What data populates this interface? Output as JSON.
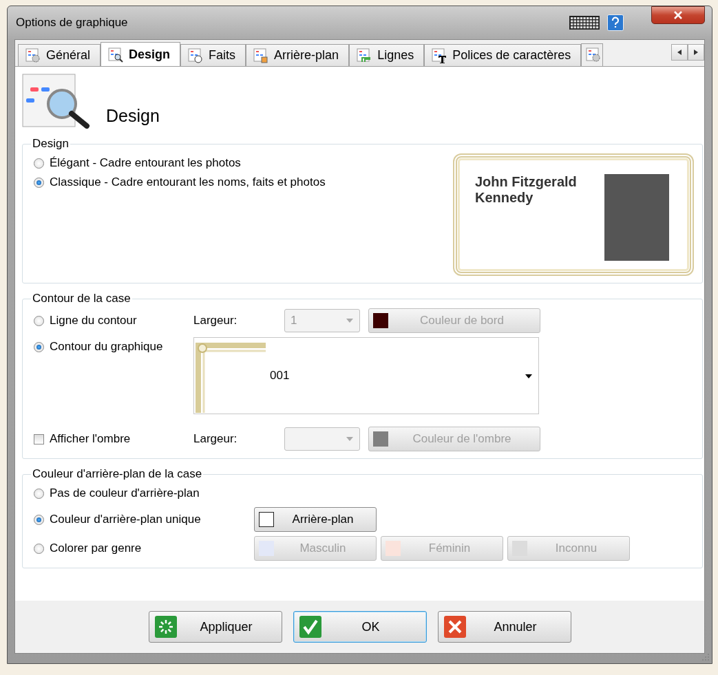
{
  "window": {
    "title": "Options de graphique"
  },
  "tabs": [
    {
      "label": "Général",
      "selected": false
    },
    {
      "label": "Design",
      "selected": true
    },
    {
      "label": "Faits",
      "selected": false
    },
    {
      "label": "Arrière-plan",
      "selected": false
    },
    {
      "label": "Lignes",
      "selected": false
    },
    {
      "label": "Polices de caractères",
      "selected": false
    }
  ],
  "header": {
    "title": "Design"
  },
  "design_group": {
    "legend": "Design",
    "options": [
      {
        "label": "Élégant - Cadre entourant les photos",
        "selected": false
      },
      {
        "label": "Classique - Cadre entourant les noms, faits et photos",
        "selected": true
      }
    ],
    "preview": {
      "name": "John Fitzgerald Kennedy"
    }
  },
  "outline_group": {
    "legend": "Contour de la case",
    "options": [
      {
        "label": "Ligne du contour",
        "selected": false
      },
      {
        "label": "Contour du graphique",
        "selected": true
      }
    ],
    "width_label": "Largeur:",
    "width_value": "1",
    "width_disabled": true,
    "border_color_button": {
      "label": "Couleur de bord",
      "color": "#3d0000",
      "disabled": true
    },
    "style_select": {
      "value": "001"
    },
    "shadow": {
      "label": "Afficher l'ombre",
      "checked": false
    },
    "shadow_width_label": "Largeur:",
    "shadow_width_disabled": true,
    "shadow_color_button": {
      "label": "Couleur de l'ombre",
      "color": "#808080",
      "disabled": true
    }
  },
  "background_group": {
    "legend": "Couleur d'arrière-plan de la case",
    "options": [
      {
        "label": "Pas de couleur d'arrière-plan",
        "selected": false
      },
      {
        "label": "Couleur d'arrière-plan unique",
        "selected": true
      },
      {
        "label": "Colorer par genre",
        "selected": false
      }
    ],
    "single_button": {
      "label": "Arrière-plan",
      "color": "#ffffff",
      "disabled": false
    },
    "gender_buttons": [
      {
        "label": "Masculin",
        "color": "#e3e8f8",
        "disabled": true
      },
      {
        "label": "Féminin",
        "color": "#fbe3dc",
        "disabled": true
      },
      {
        "label": "Inconnu",
        "color": "#dcdcdc",
        "disabled": true
      }
    ]
  },
  "footer": {
    "buttons": [
      {
        "label": "Appliquer",
        "kind": "apply",
        "focused": false
      },
      {
        "label": "OK",
        "kind": "ok",
        "focused": true
      },
      {
        "label": "Annuler",
        "kind": "cancel",
        "focused": false
      }
    ]
  }
}
